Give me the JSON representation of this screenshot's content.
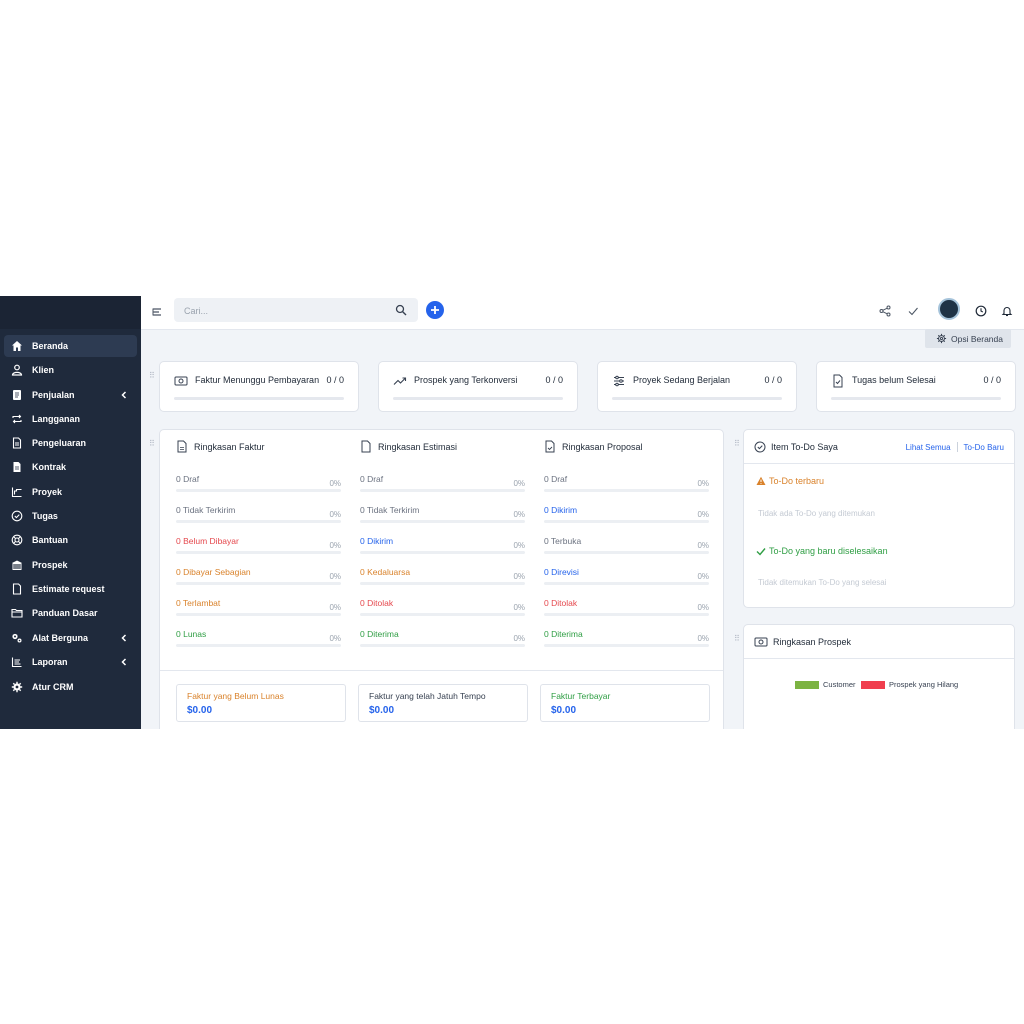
{
  "sidebar": {
    "items": [
      {
        "label": "Beranda",
        "icon": "home-icon"
      },
      {
        "label": "Klien",
        "icon": "user-icon"
      },
      {
        "label": "Penjualan",
        "icon": "file-icon"
      },
      {
        "label": "Langganan",
        "icon": "repeat-icon"
      },
      {
        "label": "Pengeluaran",
        "icon": "receipt-icon"
      },
      {
        "label": "Kontrak",
        "icon": "document-icon"
      },
      {
        "label": "Proyek",
        "icon": "chart-icon"
      },
      {
        "label": "Tugas",
        "icon": "check-circle-icon"
      },
      {
        "label": "Bantuan",
        "icon": "lifebuoy-icon"
      },
      {
        "label": "Prospek",
        "icon": "building-icon"
      },
      {
        "label": "Estimate request",
        "icon": "page-icon"
      },
      {
        "label": "Panduan Dasar",
        "icon": "folder-icon"
      },
      {
        "label": "Alat Berguna",
        "icon": "gears-icon"
      },
      {
        "label": "Laporan",
        "icon": "line-chart-icon"
      },
      {
        "label": "Atur CRM",
        "icon": "cog-icon"
      }
    ]
  },
  "topbar": {
    "search_placeholder": "Cari...",
    "opsi_label": "Opsi Beranda"
  },
  "stats": [
    {
      "label": "Faktur Menunggu Pembayaran",
      "value": "0 / 0",
      "progress": 0
    },
    {
      "label": "Prospek yang Terkonversi",
      "value": "0 / 0",
      "progress": 0
    },
    {
      "label": "Proyek Sedang Berjalan",
      "value": "0 / 0",
      "progress": 0
    },
    {
      "label": "Tugas belum Selesai",
      "value": "0 / 0",
      "progress": 0
    }
  ],
  "summary": {
    "columns": [
      {
        "title": "Ringkasan Faktur",
        "rows": [
          {
            "text": "0 Draf",
            "pct": "0%",
            "color": "#6b7280"
          },
          {
            "text": "0 Tidak Terkirim",
            "pct": "0%",
            "color": "#6b7280"
          },
          {
            "text": "0 Belum Dibayar",
            "pct": "0%",
            "color": "#e5484d"
          },
          {
            "text": "0 Dibayar Sebagian",
            "pct": "0%",
            "color": "#d9822b"
          },
          {
            "text": "0 Terlambat",
            "pct": "0%",
            "color": "#d9822b"
          },
          {
            "text": "0 Lunas",
            "pct": "0%",
            "color": "#2f9e44"
          }
        ]
      },
      {
        "title": "Ringkasan Estimasi",
        "rows": [
          {
            "text": "0 Draf",
            "pct": "0%",
            "color": "#6b7280"
          },
          {
            "text": "0 Tidak Terkirim",
            "pct": "0%",
            "color": "#6b7280"
          },
          {
            "text": "0 Dikirim",
            "pct": "0%",
            "color": "#2563eb"
          },
          {
            "text": "0 Kedaluarsa",
            "pct": "0%",
            "color": "#d9822b"
          },
          {
            "text": "0 Ditolak",
            "pct": "0%",
            "color": "#e5484d"
          },
          {
            "text": "0 Diterima",
            "pct": "0%",
            "color": "#2f9e44"
          }
        ]
      },
      {
        "title": "Ringkasan Proposal",
        "rows": [
          {
            "text": "0 Draf",
            "pct": "0%",
            "color": "#6b7280"
          },
          {
            "text": "0 Dikirim",
            "pct": "0%",
            "color": "#2563eb"
          },
          {
            "text": "0 Terbuka",
            "pct": "0%",
            "color": "#6b7280"
          },
          {
            "text": "0 Direvisi",
            "pct": "0%",
            "color": "#2563eb"
          },
          {
            "text": "0 Ditolak",
            "pct": "0%",
            "color": "#e5484d"
          },
          {
            "text": "0 Diterima",
            "pct": "0%",
            "color": "#2f9e44"
          }
        ]
      }
    ],
    "money": [
      {
        "label": "Faktur yang Belum Lunas",
        "value": "$0.00",
        "color": "#d9822b"
      },
      {
        "label": "Faktur yang telah Jatuh Tempo",
        "value": "$0.00",
        "color": "#374151"
      },
      {
        "label": "Faktur Terbayar",
        "value": "$0.00",
        "color": "#2f9e44"
      }
    ]
  },
  "todo": {
    "title": "Item To-Do Saya",
    "view_all": "Lihat Semua",
    "new": "To-Do Baru",
    "latest_title": "To-Do terbaru",
    "latest_empty": "Tidak ada To-Do yang ditemukan",
    "done_title": "To-Do yang baru diselesaikan",
    "done_empty": "Tidak ditemukan To-Do yang selesai"
  },
  "prospect": {
    "title": "Ringkasan Prospek",
    "legend": [
      {
        "name": "Customer",
        "color": "#7cb342"
      },
      {
        "name": "Prospek yang Hilang",
        "color": "#f03e4e"
      }
    ]
  },
  "colors": {
    "accent": "#2563eb",
    "sidebar": "#1f2a3c"
  }
}
